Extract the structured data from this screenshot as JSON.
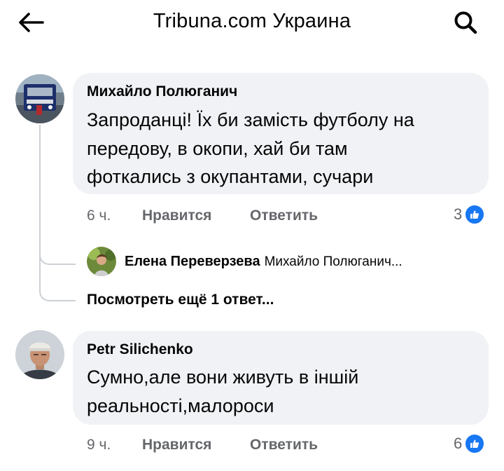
{
  "header": {
    "title": "Tribuna.com Украина"
  },
  "comments": [
    {
      "author": "Михайло Полюганич",
      "text_lines": [
        "Запроданці! Їх би замість футболу на",
        "передову, в окопи, хай би там",
        "фоткались з окупантами, сучари"
      ],
      "time": "6 ч.",
      "like_label": "Нравится",
      "reply_label": "Ответить",
      "reactions": "3",
      "reply_preview": {
        "author": "Елена Переверзева",
        "text": "Михайло Полюганич..."
      },
      "more_replies": "Посмотреть ещё 1 ответ..."
    },
    {
      "author": "Petr Silichenko",
      "text_lines": [
        "Сумно,але вони живуть в іншій",
        "реальності,малороси"
      ],
      "time": "9 ч.",
      "like_label": "Нравится",
      "reply_label": "Ответить",
      "reactions": "6"
    }
  ],
  "colors": {
    "bubble": "#f0f2f5",
    "secondary_text": "#65676b",
    "like_blue": "#1877f2",
    "thread_line": "#ccd0d5"
  },
  "icons": [
    "arrow-left-icon",
    "search-icon",
    "thumbs-up-icon"
  ]
}
